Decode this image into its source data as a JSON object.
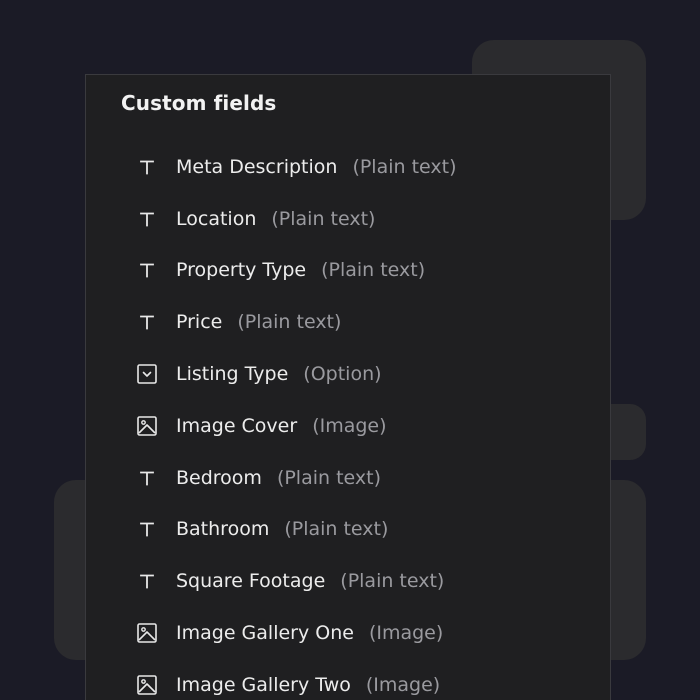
{
  "panel": {
    "title": "Custom fields"
  },
  "icons": {
    "text": "text-icon",
    "option": "option-icon",
    "image": "image-icon"
  },
  "colors": {
    "background": "#1b1b26",
    "panel": "#1f1f21",
    "panel_border": "#3a3a3e",
    "backdrop_card": "#2b2b2e",
    "field_name": "#ececec",
    "field_type": "#9a9a9f"
  },
  "fields": [
    {
      "name": "Meta Description",
      "type": "(Plain text)",
      "icon": "text"
    },
    {
      "name": "Location",
      "type": "(Plain text)",
      "icon": "text"
    },
    {
      "name": "Property Type",
      "type": "(Plain text)",
      "icon": "text"
    },
    {
      "name": "Price",
      "type": "(Plain text)",
      "icon": "text"
    },
    {
      "name": "Listing Type",
      "type": "(Option)",
      "icon": "option"
    },
    {
      "name": "Image Cover",
      "type": "(Image)",
      "icon": "image"
    },
    {
      "name": "Bedroom",
      "type": "(Plain text)",
      "icon": "text"
    },
    {
      "name": "Bathroom",
      "type": "(Plain text)",
      "icon": "text"
    },
    {
      "name": "Square Footage",
      "type": "(Plain text)",
      "icon": "text"
    },
    {
      "name": "Image Gallery One",
      "type": "(Image)",
      "icon": "image"
    },
    {
      "name": "Image Gallery Two",
      "type": "(Image)",
      "icon": "image"
    }
  ]
}
